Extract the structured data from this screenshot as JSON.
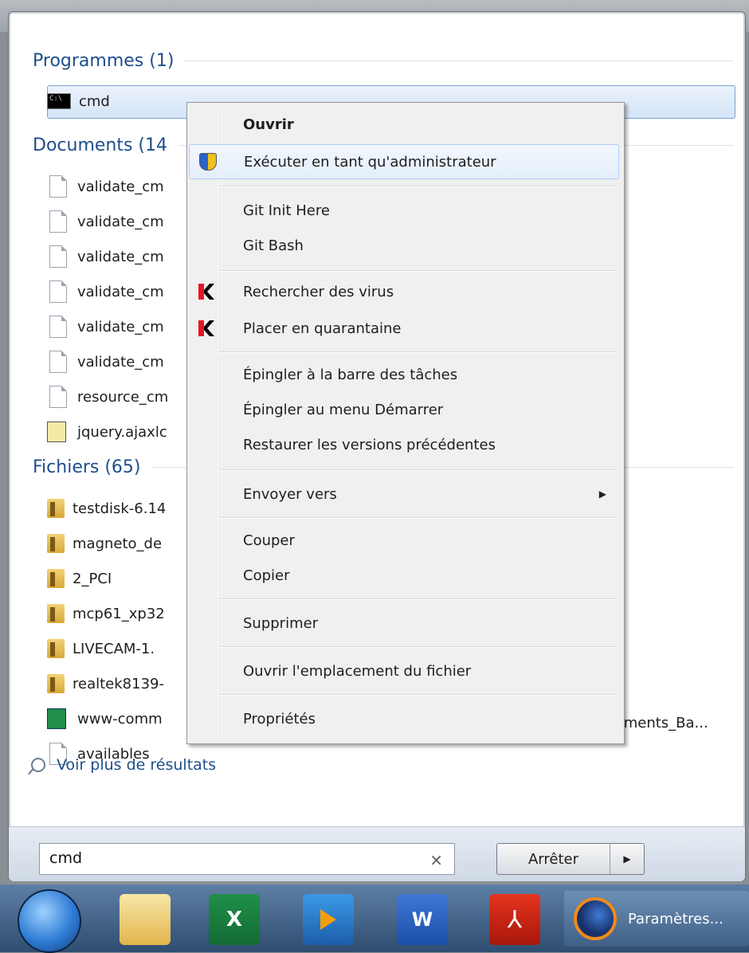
{
  "sections": {
    "programs": {
      "title": "Programmes (1)",
      "items": [
        {
          "label": "cmd",
          "icon": "cmd-icon"
        }
      ]
    },
    "documents": {
      "title": "Documents (14",
      "items": [
        {
          "label": "validate_cm",
          "icon": "document-icon"
        },
        {
          "label": "validate_cm",
          "icon": "document-icon"
        },
        {
          "label": "validate_cm",
          "icon": "document-icon"
        },
        {
          "label": "validate_cm",
          "icon": "document-icon"
        },
        {
          "label": "validate_cm",
          "icon": "document-icon"
        },
        {
          "label": "validate_cm",
          "icon": "document-icon"
        },
        {
          "label": "resource_cm",
          "icon": "document-icon"
        },
        {
          "label": "jquery.ajaxlc",
          "icon": "script-icon"
        }
      ]
    },
    "files": {
      "title": "Fichiers (65)",
      "items": [
        {
          "label": "testdisk-6.14",
          "icon": "archive-folder-icon"
        },
        {
          "label": "magneto_de",
          "icon": "archive-folder-icon"
        },
        {
          "label": "2_PCI",
          "icon": "archive-folder-icon"
        },
        {
          "label": "mcp61_xp32",
          "icon": "archive-folder-icon"
        },
        {
          "label": "LIVECAM-1.",
          "icon": "archive-folder-icon"
        },
        {
          "label": "realtek8139-",
          "icon": "archive-folder-icon"
        },
        {
          "label": "www-comm",
          "icon": "excel-file-icon"
        },
        {
          "label": "availables",
          "icon": "document-icon"
        }
      ],
      "trailing_text": "vements_Ba..."
    }
  },
  "more_results": "Voir plus de résultats",
  "search": {
    "value": "cmd",
    "clear": "×"
  },
  "stop_button": {
    "label": "Arrêter",
    "arrow": "▶"
  },
  "context_menu": {
    "items": [
      {
        "label": "Ouvrir",
        "bold": true,
        "icon": null
      },
      {
        "label": "Exécuter en tant qu'administrateur",
        "icon": "uac-shield-icon"
      },
      {
        "label": "Git Init Here",
        "icon": null
      },
      {
        "label": "Git Bash",
        "icon": null
      },
      {
        "label": "Rechercher des virus",
        "icon": "kaspersky-icon"
      },
      {
        "label": "Placer en quarantaine",
        "icon": "kaspersky-icon"
      },
      {
        "label": "Épingler à la barre des tâches",
        "icon": null
      },
      {
        "label": "Épingler au menu Démarrer",
        "icon": null
      },
      {
        "label": "Restaurer les versions précédentes",
        "icon": null
      },
      {
        "label": "Envoyer vers",
        "icon": null,
        "submenu": "▶"
      },
      {
        "label": "Couper",
        "icon": null
      },
      {
        "label": "Copier",
        "icon": null
      },
      {
        "label": "Supprimer",
        "icon": null
      },
      {
        "label": "Ouvrir l'emplacement du fichier",
        "icon": null
      },
      {
        "label": "Propriétés",
        "icon": null
      }
    ]
  },
  "taskbar": {
    "excel_label": "X",
    "word_label": "W",
    "pdf_label": "⅄",
    "active_window": "Paramètres..."
  }
}
